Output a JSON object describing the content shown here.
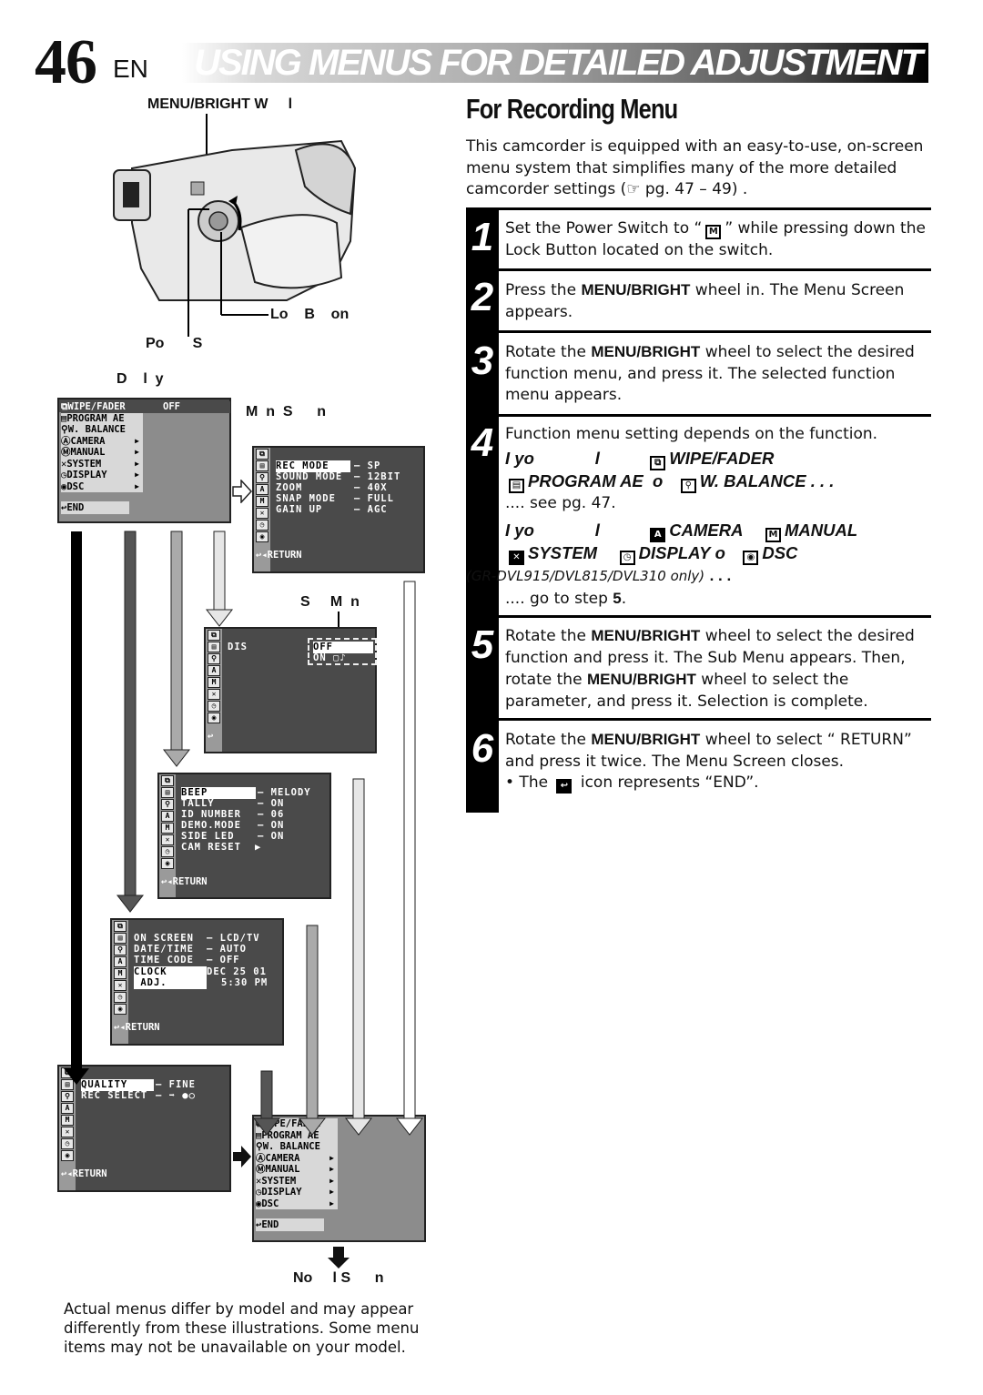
{
  "header": {
    "page_number": "46",
    "language": "EN",
    "title": "USING MENUS FOR DETAILED ADJUSTMENT"
  },
  "section": {
    "heading": "For Recording Menu",
    "intro": "This camcorder is equipped with an easy-to-use, on-screen menu system that simplifies many of the more detailed camcorder settings (☞ pg. 47 – 49) ."
  },
  "steps": [
    {
      "num": "1",
      "text_a": "Set the Power Switch to “",
      "icon": "M",
      "text_b": "” while pressing down the Lock Button located on the switch."
    },
    {
      "num": "2",
      "pre": "Press the ",
      "bold": "MENU/BRIGHT",
      "post": " wheel in. The Menu Screen appears."
    },
    {
      "num": "3",
      "pre": "Rotate the ",
      "bold": "MENU/BRIGHT",
      "post": " wheel to select the desired function menu, and press it. The selected function menu appears."
    },
    {
      "num": "4",
      "text": "Function menu setting depends on the function.",
      "case1_lead": "I yo",
      "case1_mid": "l",
      "case1_items": [
        "WIPE/FADER",
        "PROGRAM AE",
        "W. BALANCE"
      ],
      "case1_or": "o",
      "case1_ellipsis": ". . .",
      "case1_result": ".... see pg. 47.",
      "case2_lead": "I yo",
      "case2_mid": "l",
      "case2_items": [
        "CAMERA",
        "MANUAL",
        "SYSTEM",
        "DISPLAY",
        "DSC"
      ],
      "case2_or": "o",
      "case2_note": "(GR-DVL915/DVL815/DVL310 only)",
      "case2_ellipsis": ". . .",
      "case2_result_pre": ".... go to step ",
      "case2_result_step": "5",
      "case2_result_post": "."
    },
    {
      "num": "5",
      "pre": "Rotate the ",
      "bold": "MENU/BRIGHT",
      "mid": " wheel to select the desired function and press it. The Sub Menu appears. Then, rotate the ",
      "bold2": "MENU/BRIGHT",
      "post": " wheel to select the parameter, and press it. Selection is complete."
    },
    {
      "num": "6",
      "pre": "Rotate the ",
      "bold": "MENU/BRIGHT",
      "post": " wheel to select “  RETURN” and press it twice. The Menu Screen closes.",
      "bullet": "• The ",
      "bullet_post": " icon represents “END”."
    }
  ],
  "diagram": {
    "label_wheel": "MENU/BRIGHT W     l",
    "label_lock": "Lo    B    on",
    "label_power": "Po       S",
    "label_display": "D    l  y",
    "label_menu_screen": "M  n  S      n",
    "label_sub_menu": "S     M  n",
    "label_normal": "No     l S      n",
    "main_menu": {
      "items": [
        "WIPE/FADER",
        "PROGRAM AE",
        "W. BALANCE",
        "CAMERA",
        "MANUAL",
        "SYSTEM",
        "DISPLAY",
        "DSC"
      ],
      "submenu_flags": [
        false,
        false,
        false,
        true,
        true,
        true,
        true,
        true
      ],
      "value_first": "OFF",
      "end": "END"
    },
    "camera_menu": {
      "rows": [
        [
          "REC MODE",
          "SP"
        ],
        [
          "SOUND MODE",
          "12BIT"
        ],
        [
          "ZOOM",
          "40X"
        ],
        [
          "SNAP MODE",
          "FULL"
        ],
        [
          "GAIN UP",
          "AGC"
        ]
      ],
      "return": "RETURN"
    },
    "manual_menu": {
      "rows": [
        [
          "DIS",
          ""
        ]
      ],
      "options": [
        "OFF",
        "ON ▢♪"
      ]
    },
    "system_menu": {
      "rows": [
        [
          "BEEP",
          "MELODY"
        ],
        [
          "TALLY",
          "ON"
        ],
        [
          "ID NUMBER",
          "06"
        ],
        [
          "DEMO.MODE",
          "ON"
        ],
        [
          "SIDE LED",
          "ON"
        ],
        [
          "CAM RESET",
          "▶"
        ]
      ],
      "return": "RETURN"
    },
    "display_menu": {
      "rows": [
        [
          "ON SCREEN",
          "LCD/TV"
        ],
        [
          "DATE/TIME",
          "AUTO"
        ],
        [
          "TIME CODE",
          "OFF"
        ]
      ],
      "clock_label": [
        "CLOCK",
        " ADJ."
      ],
      "clock_value": [
        "DEC 25 01",
        "5:30 PM"
      ],
      "return": "RETURN"
    },
    "dsc_menu": {
      "rows": [
        [
          "QUALITY",
          "FINE"
        ],
        [
          "REC SELECT",
          "➡ ●○"
        ]
      ],
      "return": "RETURN"
    },
    "rail_icons": [
      "wipe",
      "program",
      "wb",
      "A",
      "M",
      "sys",
      "disp",
      "dsc"
    ]
  },
  "footnote": "Actual menus differ by model and may appear differently from these illustrations. Some menu items may not be unavailable on your model."
}
